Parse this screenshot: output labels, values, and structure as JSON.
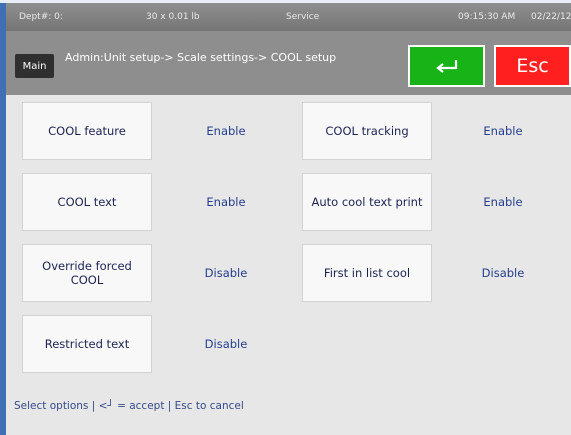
{
  "status": {
    "dept": "Dept#: 0:",
    "weight": "30 x 0.01 lb",
    "mode": "Service",
    "time": "09:15:30 AM",
    "date": "02/22/12"
  },
  "header": {
    "main_label": "Main",
    "breadcrumb": "Admin:Unit setup-> Scale settings-> COOL setup",
    "esc_label": "Esc"
  },
  "options": [
    {
      "label": "COOL feature",
      "value": "Enable"
    },
    {
      "label": "COOL tracking",
      "value": "Enable"
    },
    {
      "label": "COOL text",
      "value": "Enable"
    },
    {
      "label": "Auto cool text print",
      "value": "Enable"
    },
    {
      "label": "Override forced COOL",
      "value": "Disable"
    },
    {
      "label": "First in list cool",
      "value": "Disable"
    },
    {
      "label": "Restricted text",
      "value": "Disable"
    }
  ],
  "footer": {
    "text": "Select options | <┘ = accept | Esc to cancel"
  },
  "colors": {
    "accept": "#17b317",
    "escape": "#ff1f1f",
    "header": "#8e8e8e"
  },
  "icons": {
    "enter": "enter-arrow-icon"
  }
}
